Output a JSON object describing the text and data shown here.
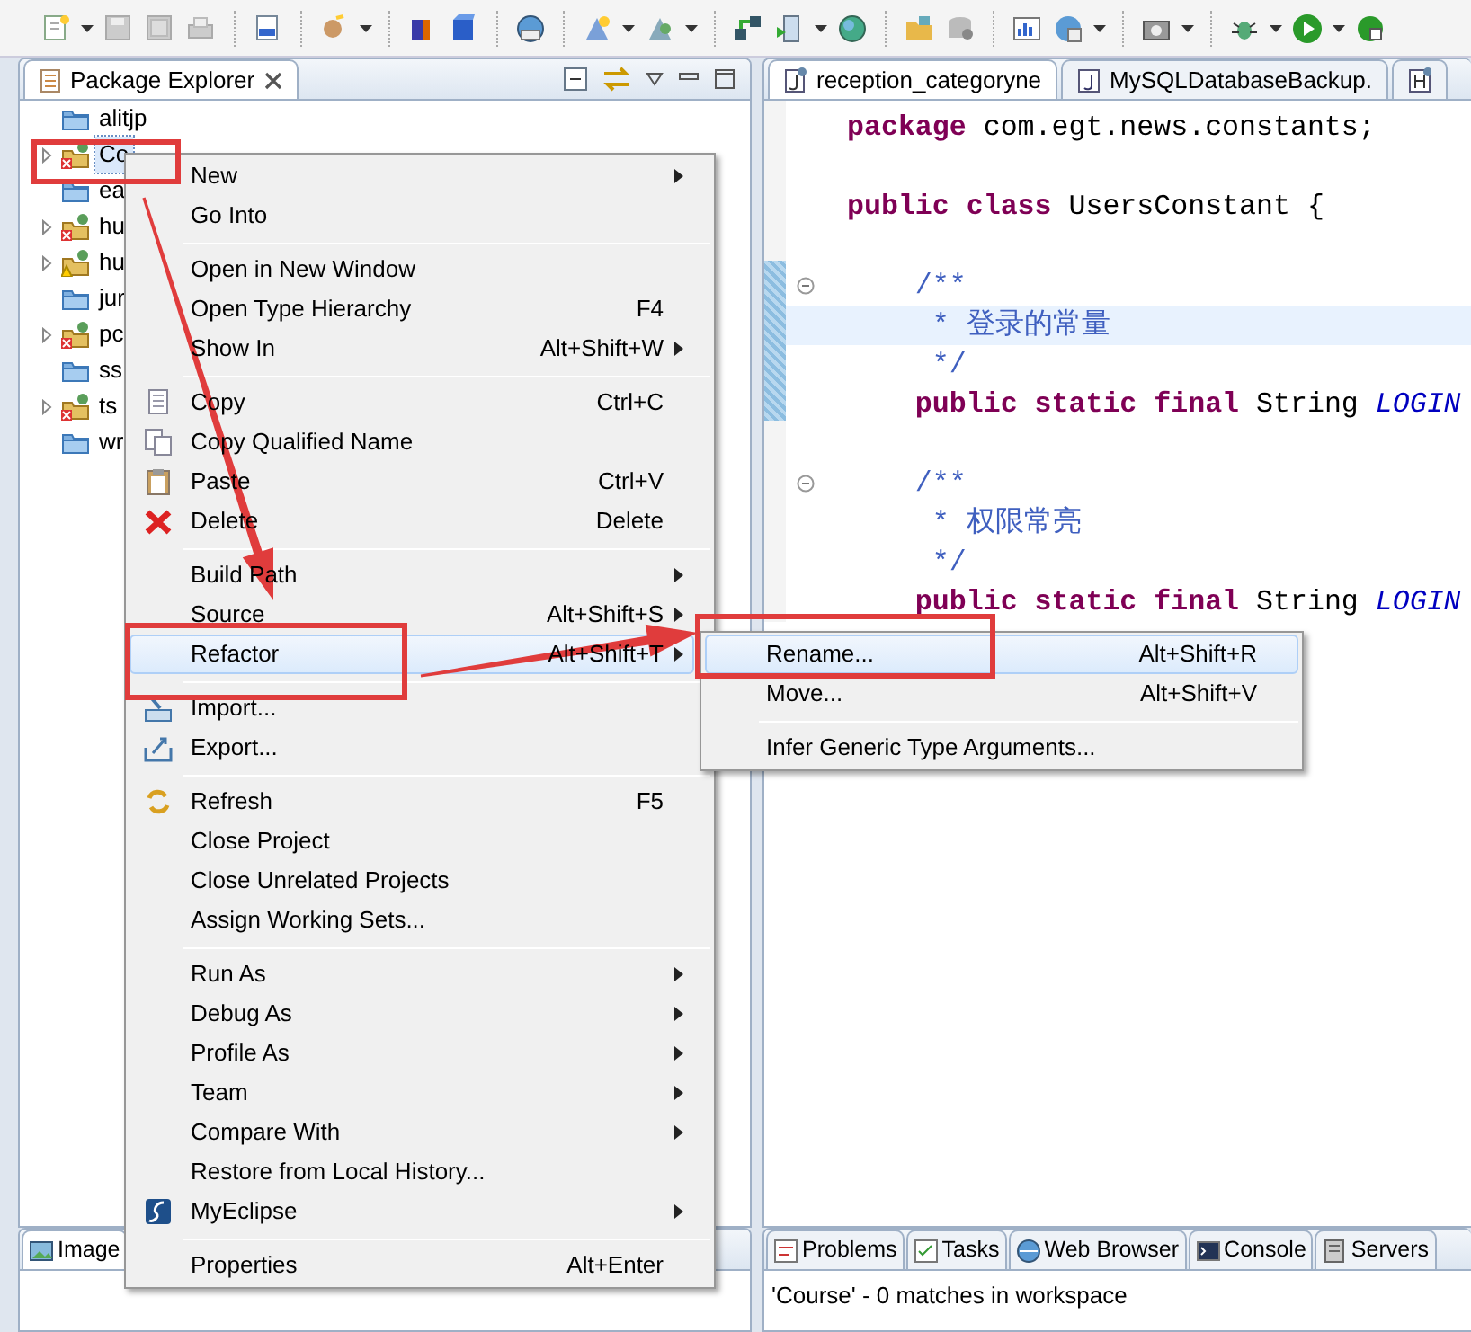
{
  "explorer": {
    "title": "Package Explorer",
    "items": [
      {
        "label": "alitjp",
        "kind": "folder",
        "expandable": false,
        "selected": false
      },
      {
        "label": "Co",
        "kind": "project",
        "expandable": true,
        "selected": true
      },
      {
        "label": "ea",
        "kind": "folder",
        "expandable": false,
        "selected": false
      },
      {
        "label": "hu",
        "kind": "project",
        "expandable": true,
        "selected": false
      },
      {
        "label": "hu",
        "kind": "project-warning",
        "expandable": true,
        "selected": false
      },
      {
        "label": "jur",
        "kind": "folder",
        "expandable": false,
        "selected": false
      },
      {
        "label": "pc",
        "kind": "project",
        "expandable": true,
        "selected": false
      },
      {
        "label": "ss",
        "kind": "folder",
        "expandable": false,
        "selected": false
      },
      {
        "label": "ts",
        "kind": "project",
        "expandable": true,
        "selected": false
      },
      {
        "label": "wr",
        "kind": "folder",
        "expandable": false,
        "selected": false
      }
    ]
  },
  "editor": {
    "tabs": [
      {
        "label": "reception_categoryne",
        "selected": true
      },
      {
        "label": "MySQLDatabaseBackup.",
        "selected": false
      },
      {
        "selected": false
      }
    ],
    "lines": [
      {
        "kind": "code",
        "current": false,
        "tokens": [
          {
            "text": "package",
            "kind": "keyword"
          },
          {
            "text": " com.egt.news.constants;",
            "kind": "plain"
          }
        ]
      },
      {
        "kind": "blank"
      },
      {
        "kind": "code",
        "current": false,
        "tokens": [
          {
            "text": "public class",
            "kind": "keyword"
          },
          {
            "text": " UsersConstant {",
            "kind": "plain"
          }
        ]
      },
      {
        "kind": "blank"
      },
      {
        "kind": "code",
        "current": false,
        "fold": true,
        "tokens": [
          {
            "text": "    /**",
            "kind": "comment"
          }
        ]
      },
      {
        "kind": "code",
        "current": true,
        "tokens": [
          {
            "text": "     * 登录的常量",
            "kind": "comment"
          }
        ]
      },
      {
        "kind": "code",
        "current": false,
        "tokens": [
          {
            "text": "     */",
            "kind": "comment"
          }
        ]
      },
      {
        "kind": "code",
        "current": false,
        "tokens": [
          {
            "text": "    public static final",
            "kind": "keyword"
          },
          {
            "text": " String ",
            "kind": "plain"
          },
          {
            "text": "LOGIN",
            "kind": "constant"
          }
        ]
      },
      {
        "kind": "blank"
      },
      {
        "kind": "code",
        "current": false,
        "fold": true,
        "tokens": [
          {
            "text": "    /**",
            "kind": "comment"
          }
        ]
      },
      {
        "kind": "code",
        "current": false,
        "tokens": [
          {
            "text": "     * 权限常亮",
            "kind": "comment"
          }
        ]
      },
      {
        "kind": "code",
        "current": false,
        "tokens": [
          {
            "text": "     */",
            "kind": "comment"
          }
        ]
      },
      {
        "kind": "code",
        "current": false,
        "tokens": [
          {
            "text": "    public static final",
            "kind": "keyword"
          },
          {
            "text": " String ",
            "kind": "plain"
          },
          {
            "text": "LOGIN",
            "kind": "constant"
          }
        ]
      }
    ]
  },
  "bottom_left": {
    "tab": "Image"
  },
  "bottom_right": {
    "tabs": [
      {
        "label": "Problems"
      },
      {
        "label": "Tasks"
      },
      {
        "label": "Web Browser"
      },
      {
        "label": "Console"
      },
      {
        "label": "Servers"
      }
    ],
    "status": "'Course' - 0 matches in workspace"
  },
  "context_menu": {
    "groups": [
      [
        {
          "label": "New",
          "submenu": true,
          "selected": false
        },
        {
          "label": "Go Into",
          "submenu": false,
          "selected": false
        }
      ],
      [
        {
          "label": "Open in New Window",
          "submenu": false,
          "selected": false
        },
        {
          "label": "Open Type Hierarchy",
          "shortcut": "F4",
          "submenu": false,
          "selected": false
        },
        {
          "label": "Show In",
          "shortcut": "Alt+Shift+W",
          "submenu": true,
          "selected": false
        }
      ],
      [
        {
          "label": "Copy",
          "shortcut": "Ctrl+C",
          "submenu": false,
          "selected": false
        },
        {
          "label": "Copy Qualified Name",
          "submenu": false,
          "selected": false
        },
        {
          "label": "Paste",
          "shortcut": "Ctrl+V",
          "submenu": false,
          "selected": false
        },
        {
          "label": "Delete",
          "shortcut": "Delete",
          "submenu": false,
          "selected": false
        }
      ],
      [
        {
          "label": "Build Path",
          "submenu": true,
          "selected": false
        },
        {
          "label": "Source",
          "shortcut": "Alt+Shift+S",
          "submenu": true,
          "selected": false
        },
        {
          "label": "Refactor",
          "shortcut": "Alt+Shift+T",
          "submenu": true,
          "selected": true
        }
      ],
      [
        {
          "label": "Import...",
          "submenu": false,
          "selected": false
        },
        {
          "label": "Export...",
          "submenu": false,
          "selected": false
        }
      ],
      [
        {
          "label": "Refresh",
          "shortcut": "F5",
          "submenu": false,
          "selected": false
        },
        {
          "label": "Close Project",
          "submenu": false,
          "selected": false
        },
        {
          "label": "Close Unrelated Projects",
          "submenu": false,
          "selected": false
        },
        {
          "label": "Assign Working Sets...",
          "submenu": false,
          "selected": false
        }
      ],
      [
        {
          "label": "Run As",
          "submenu": true,
          "selected": false
        },
        {
          "label": "Debug As",
          "submenu": true,
          "selected": false
        },
        {
          "label": "Profile As",
          "submenu": true,
          "selected": false
        },
        {
          "label": "Team",
          "submenu": true,
          "selected": false
        },
        {
          "label": "Compare With",
          "submenu": true,
          "selected": false
        },
        {
          "label": "Restore from Local History...",
          "submenu": false,
          "selected": false
        },
        {
          "label": "MyEclipse",
          "submenu": true,
          "selected": false
        }
      ],
      [
        {
          "label": "Properties",
          "shortcut": "Alt+Enter",
          "submenu": false,
          "selected": false
        }
      ]
    ]
  },
  "refactor_submenu": {
    "groups": [
      [
        {
          "label": "Rename...",
          "shortcut": "Alt+Shift+R",
          "submenu": false,
          "selected": true
        },
        {
          "label": "Move...",
          "shortcut": "Alt+Shift+V",
          "submenu": false,
          "selected": false
        }
      ],
      [
        {
          "label": "Infer Generic Type Arguments...",
          "submenu": false,
          "selected": false
        }
      ]
    ]
  }
}
